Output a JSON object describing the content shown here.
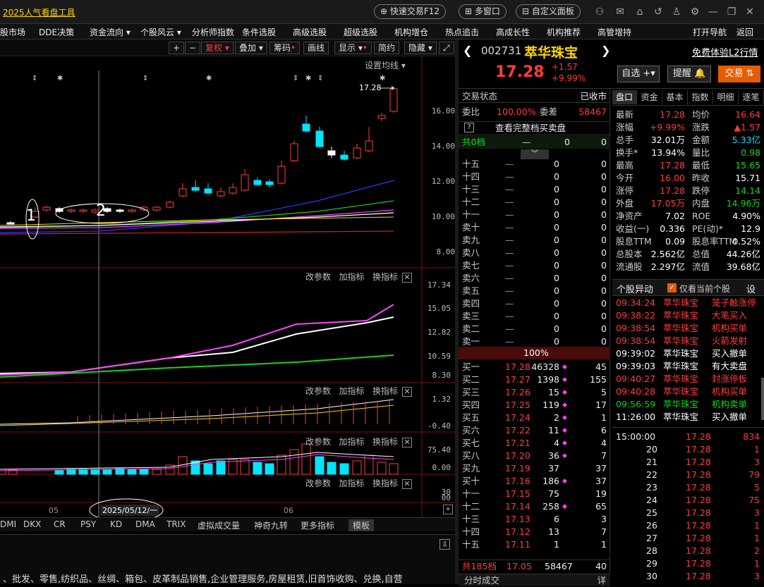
{
  "titlebar": {
    "title": "2025人气看盘工具",
    "buttons": [
      "快速交易F12",
      "多窗口",
      "自定义面板"
    ]
  },
  "menubar": {
    "items": [
      "股市场",
      "DDE决策",
      "资金流向",
      "个股风云",
      "分析师指数",
      "条件选股",
      "高级选股",
      "超级选股",
      "机构增仓",
      "热点追击",
      "高成长性",
      "机构推荐",
      "高管增持"
    ],
    "right_items": [
      "打开导航",
      "返回"
    ]
  },
  "chart_toolbar": {
    "buttons": [
      "+",
      "−",
      "复权",
      "叠加",
      "筹码",
      "画线",
      "显示",
      "简约",
      "隐藏"
    ],
    "ma_setting": "设置均线"
  },
  "chart_data": {
    "type": "candlestick",
    "price_axis": [
      "16.00",
      "14.00",
      "12.00",
      "10.00",
      "8.00"
    ],
    "last_price_label": "17.28",
    "annotations": [
      "1",
      "2"
    ],
    "ind1_axis": [
      "17.34",
      "15.05",
      "12.82",
      "10.59",
      "8.30"
    ],
    "ind2_axis": [
      "1.32",
      "-0.40"
    ],
    "ind3_axis": [
      "75.40",
      "0.00"
    ],
    "ind4_axis": [
      "30",
      "00"
    ],
    "x_labels": [
      "05",
      "06"
    ],
    "crosshair_date": "2025/05/12/一",
    "panel_tools": [
      "改参数",
      "加指标",
      "换指标"
    ]
  },
  "indicator_tabs": [
    "DMI",
    "DKX",
    "CR",
    "PSY",
    "KD",
    "DMA",
    "TRIX",
    "虚拟成交量",
    "神奇九转",
    "更多指标",
    "模板"
  ],
  "business_text": "、批发、零售,纺织品、丝绸、箱包、皮革制品销售,企业管理服务,房屋租赁,旧首饰收购、兑换,自营",
  "stock": {
    "code": "002731",
    "name": "萃华珠宝",
    "price": "17.28",
    "change": "+1.57",
    "change_pct": "+9.99%",
    "l2_link": "免费体验L2行情",
    "btn_watch": "自选",
    "btn_alert": "提醒",
    "btn_trade": "交易"
  },
  "orderbook": {
    "status_label": "交易状态",
    "status_value": "已收市",
    "ratio_label": "委比",
    "ratio_value": "100.00%",
    "diff_label": "委差",
    "diff_value": "58467",
    "full_link": "查看完整档买卖盘",
    "total_sell_label": "共0档",
    "sells": [
      {
        "label": "十五",
        "price": "—",
        "vol": "0",
        "n": "0"
      },
      {
        "label": "十四",
        "price": "—",
        "vol": "0",
        "n": "0"
      },
      {
        "label": "十三",
        "price": "—",
        "vol": "0",
        "n": "0"
      },
      {
        "label": "十二",
        "price": "—",
        "vol": "0",
        "n": "0"
      },
      {
        "label": "十一",
        "price": "—",
        "vol": "0",
        "n": "0"
      },
      {
        "label": "卖十",
        "price": "—",
        "vol": "0",
        "n": "0"
      },
      {
        "label": "卖九",
        "price": "—",
        "vol": "0",
        "n": "0"
      },
      {
        "label": "卖八",
        "price": "—",
        "vol": "0",
        "n": "0"
      },
      {
        "label": "卖七",
        "price": "—",
        "vol": "0",
        "n": "0"
      },
      {
        "label": "卖六",
        "price": "—",
        "vol": "0",
        "n": "0"
      },
      {
        "label": "卖五",
        "price": "—",
        "vol": "0",
        "n": "0"
      },
      {
        "label": "卖四",
        "price": "—",
        "vol": "0",
        "n": "0"
      },
      {
        "label": "卖三",
        "price": "—",
        "vol": "0",
        "n": "0"
      },
      {
        "label": "卖二",
        "price": "—",
        "vol": "0",
        "n": "0"
      },
      {
        "label": "卖一",
        "price": "—",
        "vol": "0",
        "n": "0"
      }
    ],
    "pct_bar": "100%",
    "buys": [
      {
        "label": "买一",
        "price": "17.28",
        "vol": "46328",
        "n": "45",
        "mark": "◆"
      },
      {
        "label": "买二",
        "price": "17.27",
        "vol": "1398",
        "n": "155",
        "mark": "◆"
      },
      {
        "label": "买三",
        "price": "17.26",
        "vol": "15",
        "n": "5",
        "mark": "◆"
      },
      {
        "label": "买四",
        "price": "17.25",
        "vol": "119",
        "n": "17",
        "mark": "◆"
      },
      {
        "label": "买五",
        "price": "17.24",
        "vol": "2",
        "n": "1",
        "mark": "◆"
      },
      {
        "label": "买六",
        "price": "17.22",
        "vol": "11",
        "n": "6",
        "mark": "◆"
      },
      {
        "label": "买七",
        "price": "17.21",
        "vol": "4",
        "n": "4",
        "mark": "◆"
      },
      {
        "label": "买八",
        "price": "17.20",
        "vol": "36",
        "n": "7",
        "mark": "◆"
      },
      {
        "label": "买九",
        "price": "17.19",
        "vol": "37",
        "n": "37",
        "mark": ""
      },
      {
        "label": "买十",
        "price": "17.16",
        "vol": "186",
        "n": "37",
        "mark": "◆"
      },
      {
        "label": "十一",
        "price": "17.15",
        "vol": "75",
        "n": "19",
        "mark": ""
      },
      {
        "label": "十二",
        "price": "17.14",
        "vol": "258",
        "n": "65",
        "mark": "◆"
      },
      {
        "label": "十三",
        "price": "17.13",
        "vol": "6",
        "n": "3",
        "mark": ""
      },
      {
        "label": "十四",
        "price": "17.12",
        "vol": "13",
        "n": "7",
        "mark": ""
      },
      {
        "label": "十五",
        "price": "17.11",
        "vol": "1",
        "n": "1",
        "mark": ""
      }
    ],
    "total_buy_label": "共185档",
    "total_buy_price": "17.05",
    "total_buy_vol": "58467",
    "total_buy_n": "40",
    "footer_label": "分时成交",
    "footer_btn": "详"
  },
  "quote_tabs": [
    "盘口",
    "资金",
    "基本",
    "指数",
    "明细",
    "逐笔"
  ],
  "quote": [
    {
      "l1": "最新",
      "v1": "17.28",
      "c1": "red",
      "l2": "均价",
      "v2": "16.64",
      "c2": "red"
    },
    {
      "l1": "涨幅",
      "v1": "+9.99%",
      "c1": "red",
      "l2": "涨跌",
      "v2": "▲1.57",
      "c2": "red"
    },
    {
      "l1": "总手",
      "v1": "32.01万",
      "c1": "white",
      "l2": "金额",
      "v2": "5.33亿",
      "c2": "cyan"
    },
    {
      "l1": "换手*",
      "v1": "13.94%",
      "c1": "white",
      "l2": "量比",
      "v2": "0.98",
      "c2": "green"
    },
    {
      "l1": "最高",
      "v1": "17.28",
      "c1": "red",
      "l2": "最低",
      "v2": "15.65",
      "c2": "green"
    },
    {
      "l1": "今开",
      "v1": "16.00",
      "c1": "red",
      "l2": "昨收",
      "v2": "15.71",
      "c2": "white"
    },
    {
      "l1": "涨停",
      "v1": "17.28",
      "c1": "red",
      "l2": "跌停",
      "v2": "14.14",
      "c2": "green"
    },
    {
      "l1": "外盘",
      "v1": "17.05万",
      "c1": "red",
      "l2": "内盘",
      "v2": "14.96万",
      "c2": "green"
    },
    {
      "l1": "净资产",
      "v1": "7.02",
      "c1": "white",
      "l2": "ROE",
      "v2": "4.90%",
      "c2": "white"
    },
    {
      "l1": "收益(一)",
      "v1": "0.336",
      "c1": "white",
      "l2": "PE(动)*",
      "v2": "12.9",
      "c2": "white"
    },
    {
      "l1": "股息TTM",
      "v1": "0.09",
      "c1": "white",
      "l2": "股息率TTM",
      "v2": "0.52%",
      "c2": "white"
    },
    {
      "l1": "总股本",
      "v1": "2.562亿",
      "c1": "white",
      "l2": "总值",
      "v2": "44.26亿",
      "c2": "white"
    },
    {
      "l1": "流通股",
      "v1": "2.297亿",
      "c1": "white",
      "l2": "流值",
      "v2": "39.68亿",
      "c2": "white"
    }
  ],
  "movements": {
    "title": "个股异动",
    "checkbox_label": "仅看当前个股",
    "settings": "设",
    "rows": [
      {
        "t": "09:34:24",
        "n": "萃华珠宝",
        "e": "笼子触涨停",
        "c": "red"
      },
      {
        "t": "09:38:22",
        "n": "萃华珠宝",
        "e": "大笔买入",
        "c": "red"
      },
      {
        "t": "09:38:54",
        "n": "萃华珠宝",
        "e": "机构买单",
        "c": "red"
      },
      {
        "t": "09:38:54",
        "n": "萃华珠宝",
        "e": "火箭发射",
        "c": "red"
      },
      {
        "t": "09:39:02",
        "n": "萃华珠宝",
        "e": "买入撤单",
        "c": "white"
      },
      {
        "t": "09:39:03",
        "n": "萃华珠宝",
        "e": "有大卖盘",
        "c": "white"
      },
      {
        "t": "09:40:27",
        "n": "萃华珠宝",
        "e": "封涨停板",
        "c": "red"
      },
      {
        "t": "09:40:28",
        "n": "萃华珠宝",
        "e": "机构买单",
        "c": "red"
      },
      {
        "t": "09:56:59",
        "n": "萃华珠宝",
        "e": "机构卖单",
        "c": "green"
      },
      {
        "t": "11:26:00",
        "n": "萃华珠宝",
        "e": "买入撤单",
        "c": "white"
      }
    ]
  },
  "trades": [
    {
      "t": "15:00:00",
      "p": "17.28",
      "v": "834"
    },
    {
      "t": "20",
      "p": "17.28",
      "v": "1"
    },
    {
      "t": "21",
      "p": "17.28",
      "v": "3"
    },
    {
      "t": "22",
      "p": "17.28",
      "v": "79"
    },
    {
      "t": "23",
      "p": "17.28",
      "v": "5"
    },
    {
      "t": "24",
      "p": "17.28",
      "v": "75"
    },
    {
      "t": "25",
      "p": "17.28",
      "v": "3"
    },
    {
      "t": "26",
      "p": "17.28",
      "v": "1"
    },
    {
      "t": "27",
      "p": "17.28",
      "v": "1"
    },
    {
      "t": "28",
      "p": "17.28",
      "v": "2"
    },
    {
      "t": "29",
      "p": "17.28",
      "v": "1"
    },
    {
      "t": "30",
      "p": "17.28",
      "v": "3"
    }
  ]
}
